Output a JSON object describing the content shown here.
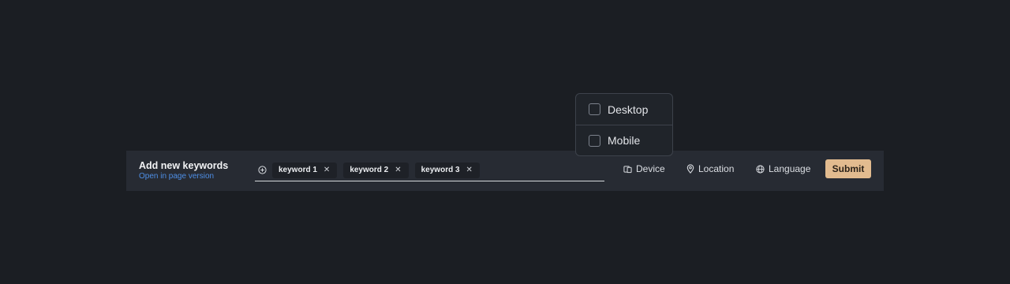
{
  "header": {
    "title": "Add new keywords",
    "link": "Open in page version"
  },
  "keywords": {
    "add_icon": "plus-circle-icon",
    "items": [
      {
        "label": "keyword 1",
        "remove_icon": "close-icon"
      },
      {
        "label": "keyword 2",
        "remove_icon": "close-icon"
      },
      {
        "label": "keyword 3",
        "remove_icon": "close-icon"
      }
    ]
  },
  "filters": {
    "device": {
      "label": "Device",
      "icon": "device-icon"
    },
    "location": {
      "label": "Location",
      "icon": "map-pin-icon"
    },
    "language": {
      "label": "Language",
      "icon": "globe-icon"
    }
  },
  "submit_label": "Submit",
  "device_dropdown": {
    "options": [
      {
        "label": "Desktop",
        "checked": false
      },
      {
        "label": "Mobile",
        "checked": false
      }
    ]
  },
  "colors": {
    "page_background": "#1b1e23",
    "bar_background": "#272b33",
    "accent": "#e2bb8f",
    "link": "#4e8fe6"
  }
}
